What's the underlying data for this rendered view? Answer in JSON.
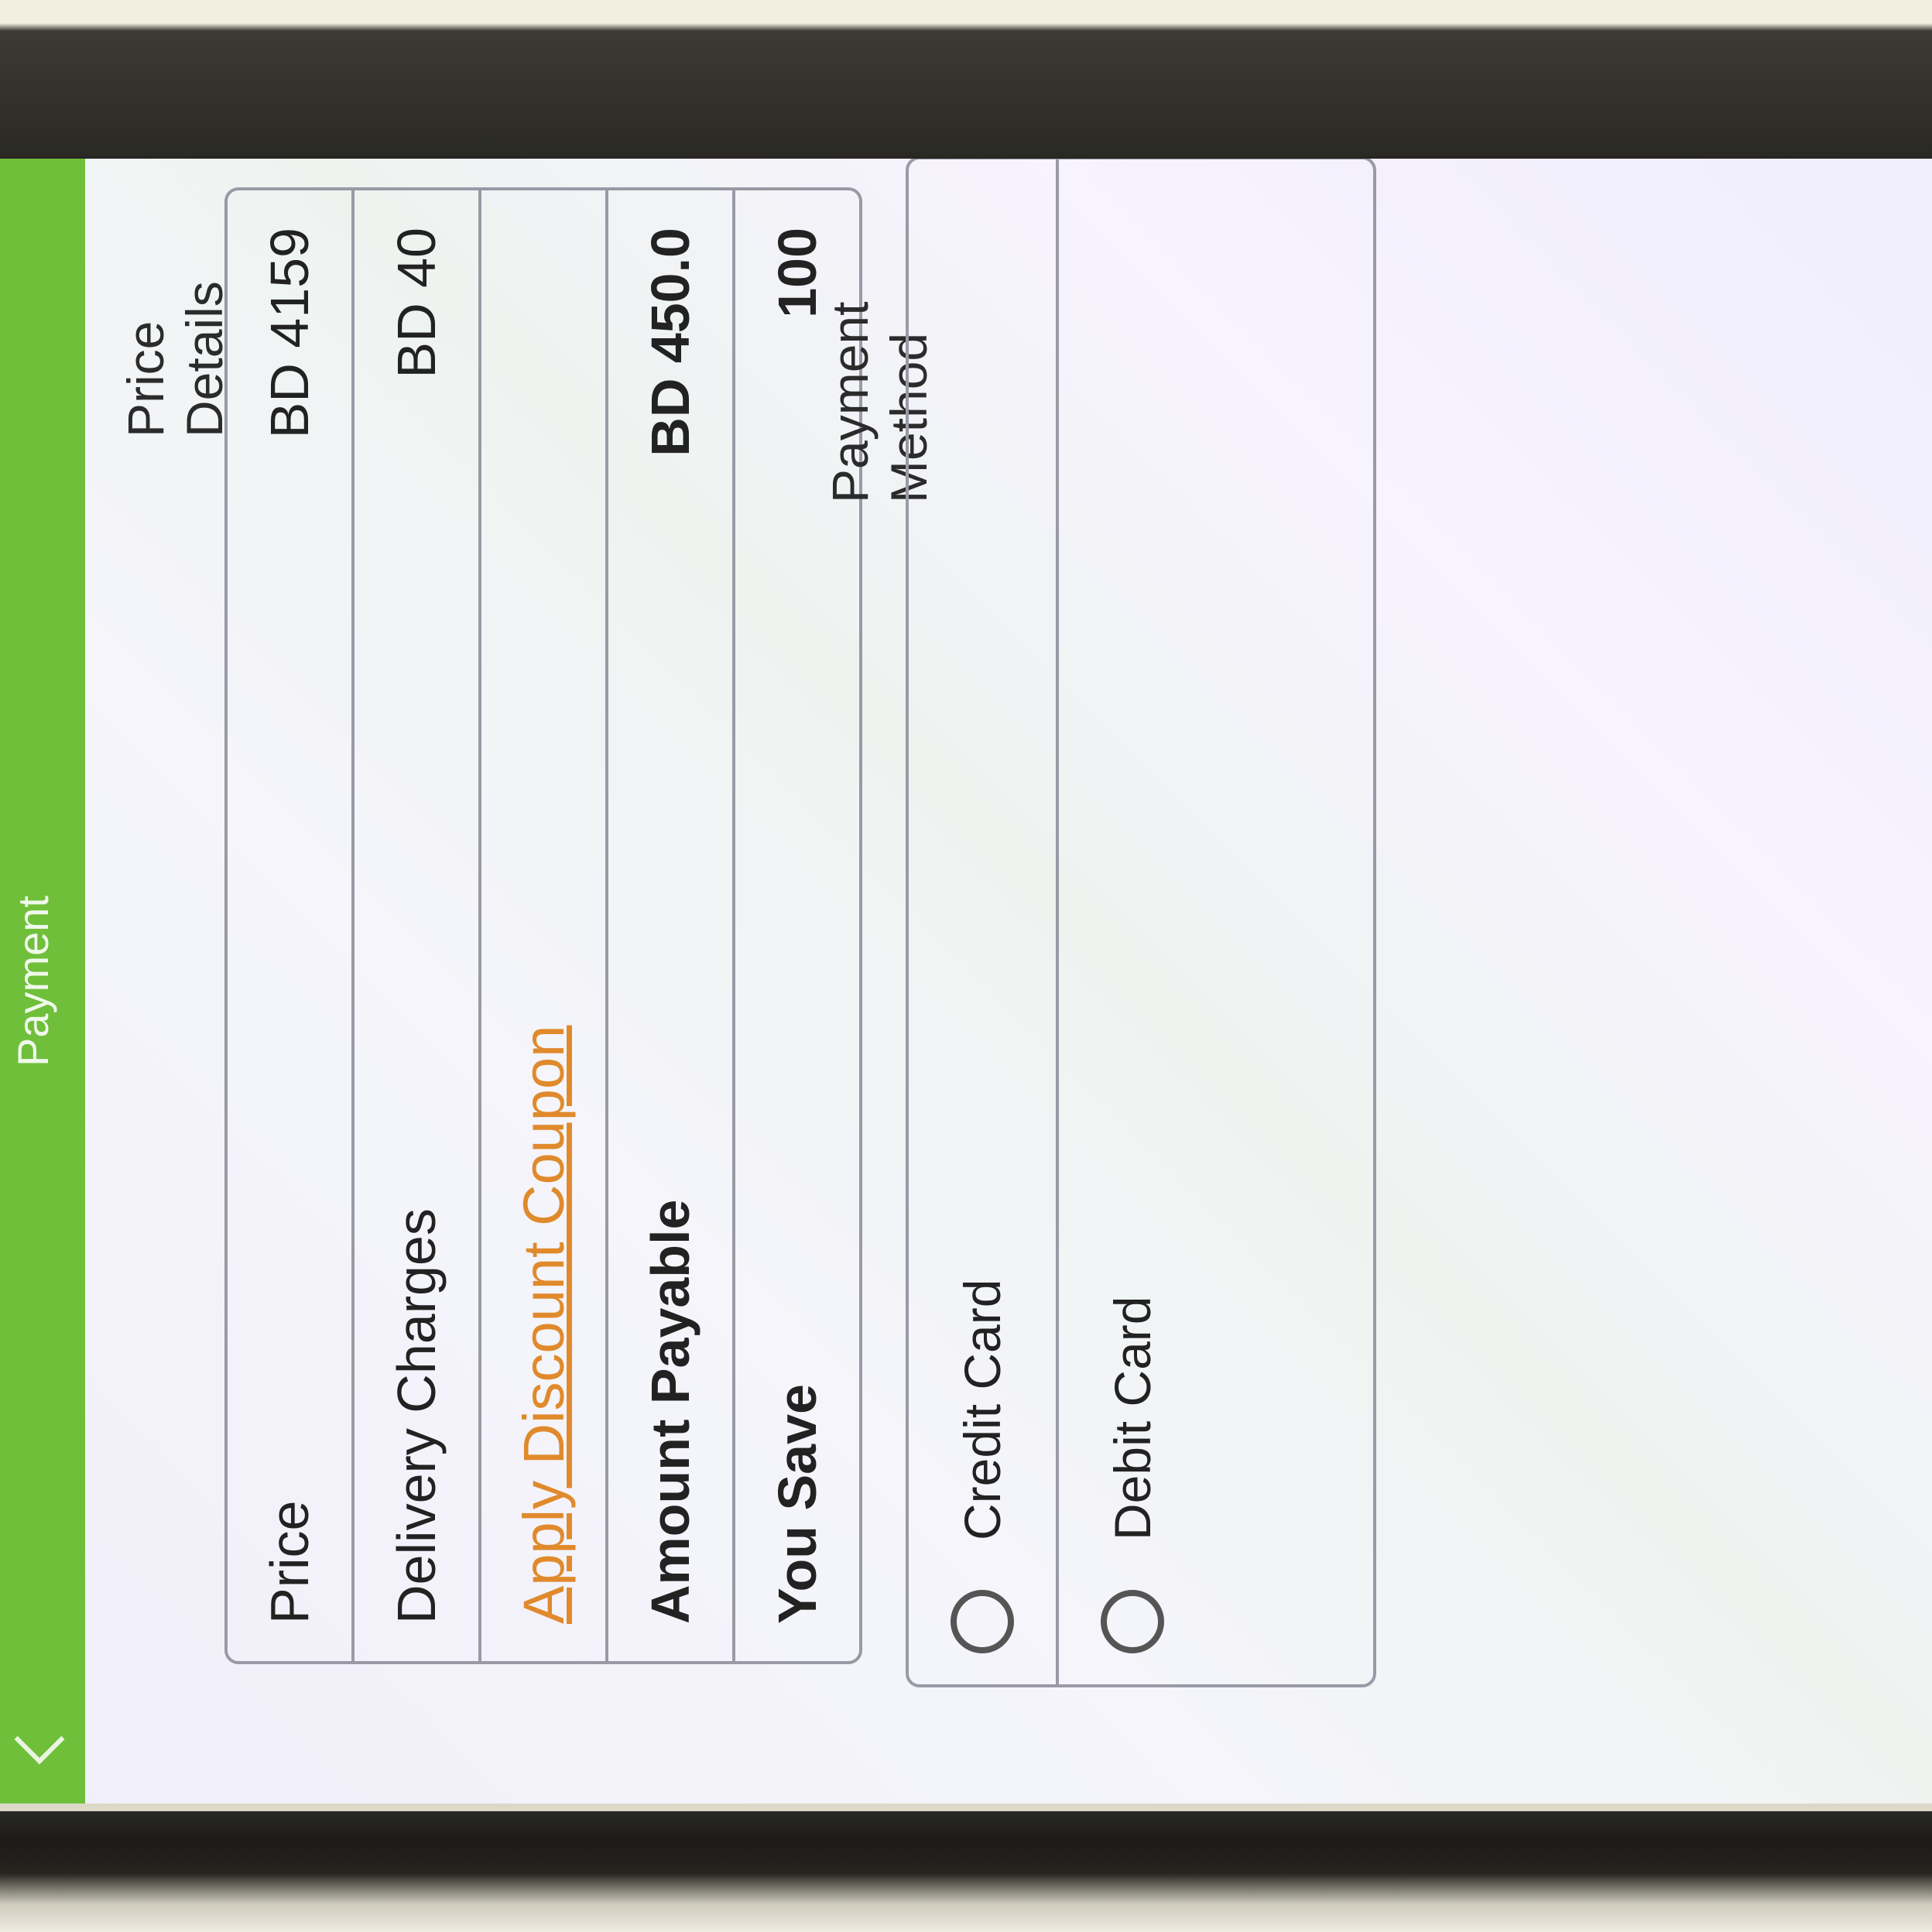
{
  "appbar": {
    "title": "Payment"
  },
  "price_details": {
    "heading": "Price Details",
    "rows": [
      {
        "label": "Price",
        "value": "BD 4159"
      },
      {
        "label": "Delivery Charges",
        "value": "BD 40"
      }
    ],
    "coupon_link": "Apply Discount Coupon",
    "amount_payable": {
      "label": "Amount Payable",
      "value": "BD 450.0"
    },
    "you_save": {
      "label": "You Save",
      "value": "100"
    }
  },
  "payment_method": {
    "heading": "Payment Method",
    "options": [
      {
        "label": "Credit Card"
      },
      {
        "label": "Debit Card"
      }
    ]
  },
  "colors": {
    "appbar": "#6fbf3a",
    "coupon_link": "#e08a2c"
  }
}
